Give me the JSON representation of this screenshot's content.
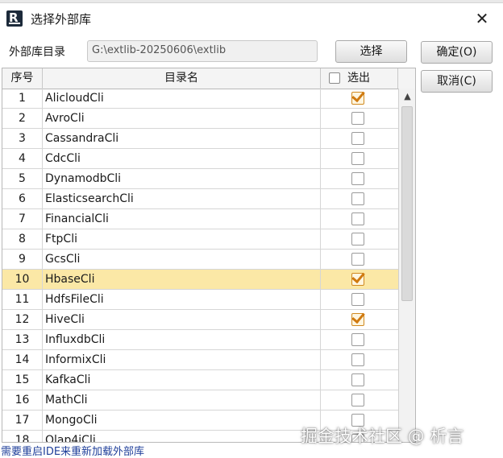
{
  "window": {
    "title": "选择外部库",
    "close_glyph": "✕",
    "app_icon": "app-r-icon"
  },
  "path": {
    "label": "外部库目录",
    "value": "G:\\extlib-20250606\\extlib"
  },
  "buttons": {
    "select": "选择",
    "ok": "确定(O)",
    "cancel": "取消(C)"
  },
  "table": {
    "headers": {
      "index": "序号",
      "name": "目录名",
      "selected": "选出"
    },
    "header_checkbox_checked": false,
    "rows": [
      {
        "index": "1",
        "name": "AlicloudCli",
        "checked": true
      },
      {
        "index": "2",
        "name": "AvroCli",
        "checked": false
      },
      {
        "index": "3",
        "name": "CassandraCli",
        "checked": false
      },
      {
        "index": "4",
        "name": "CdcCli",
        "checked": false
      },
      {
        "index": "5",
        "name": "DynamodbCli",
        "checked": false
      },
      {
        "index": "6",
        "name": "ElasticsearchCli",
        "checked": false
      },
      {
        "index": "7",
        "name": "FinancialCli",
        "checked": false
      },
      {
        "index": "8",
        "name": "FtpCli",
        "checked": false
      },
      {
        "index": "9",
        "name": "GcsCli",
        "checked": false
      },
      {
        "index": "10",
        "name": "HbaseCli",
        "checked": true,
        "highlighted": true
      },
      {
        "index": "11",
        "name": "HdfsFileCli",
        "checked": false
      },
      {
        "index": "12",
        "name": "HiveCli",
        "checked": true
      },
      {
        "index": "13",
        "name": "InfluxdbCli",
        "checked": false
      },
      {
        "index": "14",
        "name": "InformixCli",
        "checked": false
      },
      {
        "index": "15",
        "name": "KafkaCli",
        "checked": false
      },
      {
        "index": "16",
        "name": "MathCli",
        "checked": false
      },
      {
        "index": "17",
        "name": "MongoCli",
        "checked": false
      },
      {
        "index": "18",
        "name": "Olap4jCli",
        "checked": false
      }
    ]
  },
  "status": "需要重启IDE来重新加载外部库",
  "watermark": "掘金技术社区 @ 析言",
  "colors": {
    "highlight_row": "#fbe8a6",
    "check_mark": "#d07a10",
    "status_text": "#1f3f9a"
  }
}
